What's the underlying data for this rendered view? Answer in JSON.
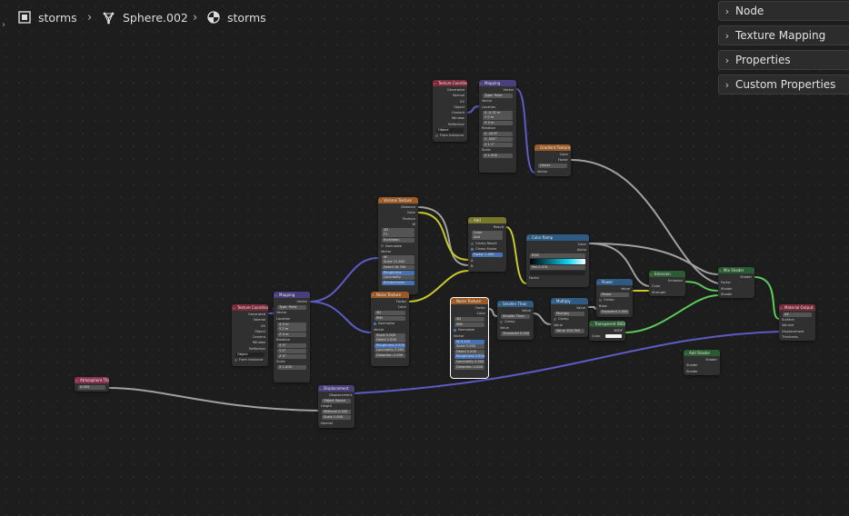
{
  "breadcrumb": {
    "items": [
      {
        "label": "storms",
        "icon": "scene-square-icon"
      },
      {
        "label": "Sphere.002",
        "icon": "mesh-vertex-icon"
      },
      {
        "label": "storms",
        "icon": "material-sphere-icon"
      }
    ]
  },
  "side_panel": {
    "tabs": [
      {
        "label": "Node"
      },
      {
        "label": "Texture Mapping"
      },
      {
        "label": "Properties"
      },
      {
        "label": "Custom Properties"
      }
    ]
  },
  "colors": {
    "background": "#1d1d1d",
    "socket_vector": "#6363c7",
    "socket_float": "#a1a1a1",
    "socket_color": "#c7c729",
    "socket_shader": "#63c763",
    "wire_vector": "#5c5cc4",
    "wire_float": "#a0a0a0",
    "wire_color": "#c8c830",
    "wire_shader": "#5acb5a"
  },
  "nodes": {
    "texcoord1": {
      "title": "Texture Coordinate",
      "rows": [
        "Generated",
        "Normal",
        "UV",
        "Object",
        "Camera",
        "Window",
        "Reflection",
        "Object",
        "From Instancer"
      ]
    },
    "mapping1": {
      "title": "Mapping",
      "rows": [
        "Vector",
        "Type: Point",
        "Vector",
        "Location",
        "X  -0.31 m",
        "Y  0 m",
        "Z  0 m",
        "Rotation",
        "X  -16.9°",
        "Y  -355°",
        "Z  1.1°",
        "Scale",
        "X  1.000",
        "Y  1.000",
        "Z  1.000"
      ]
    },
    "gradient": {
      "title": "Gradient Texture",
      "rows": [
        "Color",
        "Factor",
        "Linear",
        "Vector"
      ]
    },
    "voronoi": {
      "title": "Voronoi Texture",
      "rows": [
        "Distance",
        "Color",
        "Position",
        "W",
        "3D",
        "F1",
        "Euclidean",
        "Normalize",
        "Vector",
        "W",
        "Scale  21.600",
        "Detail  26.700",
        "Roughness",
        "Lacunarity",
        "Randomness"
      ]
    },
    "add": {
      "title": "Add",
      "rows": [
        "Result",
        "Color",
        "Add",
        "Clamp Result",
        "Clamp Factor",
        "Factor  1.000",
        "A",
        "B"
      ]
    },
    "colorramp": {
      "title": "Color Ramp",
      "rows": [
        "Color",
        "Alpha",
        "RGB",
        "Linear",
        "Pos  0.474",
        "Factor"
      ]
    },
    "emission": {
      "title": "Emission",
      "rows": [
        "Emission",
        "Color",
        "Strength"
      ]
    },
    "mixshader": {
      "title": "Mix Shader",
      "rows": [
        "Shader",
        "Factor",
        "Shader",
        "Shader"
      ]
    },
    "power": {
      "title": "Power",
      "rows": [
        "Value",
        "Power",
        "Clamp",
        "Base",
        "Exponent  2.000"
      ]
    },
    "transparent": {
      "title": "Transparent BSDF",
      "rows": [
        "BSDF",
        "Color"
      ]
    },
    "texcoord2": {
      "title": "Texture Coordinate",
      "rows": [
        "Generated",
        "Normal",
        "UV",
        "Object",
        "Camera",
        "Window",
        "Reflection",
        "Object",
        "From Instancer"
      ]
    },
    "mapping2": {
      "title": "Mapping",
      "rows": [
        "Vector",
        "Type: Point",
        "Vector",
        "Location",
        "X  0 m",
        "Y  0 m",
        "Z  0 m",
        "Rotation",
        "X  0°",
        "Y  0°",
        "Z  0°",
        "Scale",
        "X  1.000",
        "Y  1.000",
        "Z  1.000"
      ]
    },
    "noise1": {
      "title": "Noise Texture",
      "rows": [
        "Factor",
        "Color",
        "3D",
        "fBM",
        "Normalize",
        "Vector",
        "Scale  5.000",
        "Detail  2.000",
        "Roughness  0.500",
        "Lacunarity  2.000",
        "Distortion  2.000"
      ]
    },
    "noise2": {
      "title": "Noise Texture",
      "rows": [
        "Factor",
        "Color",
        "3D",
        "fBM",
        "Normalize",
        "Vector",
        "W  0.100",
        "Scale  5.000",
        "Detail  5.000",
        "Roughness  0.500",
        "Lacunarity  2.000",
        "Distortion  2.000"
      ]
    },
    "smooth": {
      "title": "Smaller Than",
      "rows": [
        "Value",
        "Smaller Than",
        "Clamp",
        "Value",
        "Threshold  0.500"
      ]
    },
    "multiply": {
      "title": "Multiply",
      "rows": [
        "Value",
        "Multiply",
        "Clamp",
        "Value",
        "Value  104.760"
      ]
    },
    "matout": {
      "title": "Material Output",
      "rows": [
        "All",
        "Surface",
        "Volume",
        "Displacement",
        "Thickness"
      ]
    },
    "addshader": {
      "title": "Add Shader",
      "rows": [
        "Shader",
        "Shader",
        "Shader"
      ]
    },
    "atmo": {
      "title": "Atmosphere Thic...",
      "rows": [
        "0.003"
      ]
    },
    "displacement": {
      "title": "Displacement",
      "rows": [
        "Displacement",
        "Object Space",
        "Height",
        "Midlevel  0.000",
        "Scale  1.000",
        "Normal"
      ]
    }
  }
}
